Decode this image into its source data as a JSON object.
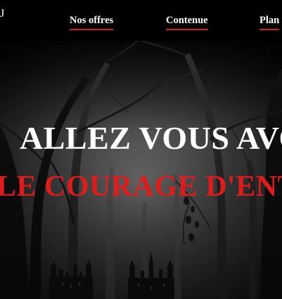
{
  "header": {
    "brand_fragment": "J",
    "nav": [
      {
        "label": "Nos offres"
      },
      {
        "label": "Contenue"
      },
      {
        "label": "Plan"
      }
    ]
  },
  "hero": {
    "headline": "ALLEZ VOUS AVOIR",
    "subheadline": "LE COURAGE D'ENTRER",
    "image": "haunted-forest-castle-image"
  },
  "colors": {
    "accent": "#e01b1b",
    "nav_underline": "#d01f1f",
    "background": "#000000",
    "text": "#ffffff"
  }
}
